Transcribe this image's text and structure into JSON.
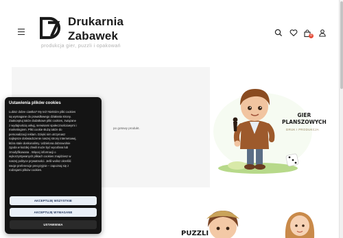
{
  "header": {
    "brand_line1": "Drukarnia",
    "brand_line2": "Zabawek",
    "tagline": "produkcja gier, puzzli i opakowań",
    "cart_count": "0",
    "icons": [
      "menu-icon",
      "search-icon",
      "heart-icon",
      "cart-icon",
      "user-icon"
    ]
  },
  "hero": {
    "text_fragment": "po gotowy produkt.",
    "banner_title_line1": "GIER",
    "banner_title_line2": "PLANSZOWYCH",
    "banner_subtitle": "DRUK I PRODUKCJA"
  },
  "second_banner": {
    "title": "PUZZLI"
  },
  "cookie_dialog": {
    "title": "Ustawienia plików cookies",
    "lines": [
      "Lubisz dobre ciastka? My też! Niektóre pliki cookies",
      "są wymagane do prawidłowego działania strony.",
      "Zaakceptuj także dodatkowe pliki cookies, związane",
      "z wydajnością usług, serwisami społecznościowymi i",
      "marketingiem. Pliki cookie służą także do",
      "personalizacji reklam. Dzięki nim otrzymasz",
      "najlepsze doświadczenie naszej strony internetowej,",
      "która stale doskonalimy. Udzielona dobrowolnie",
      "zgoda w każdej chwili może być wycofana lub",
      "zmodyfikowana . Więcej informacji o",
      "wykorzystywanych plikach cookies znajdziesz w",
      "naszej polityce prywatności. Jeśli wolisz określić",
      "swoje preferencje precyzyjnie – zapoznaj się z",
      "rodzajami plików cookies."
    ],
    "accept_all_label": "AKCEPTUJĘ WSZYSTKIE",
    "accept_required_label": "AKCEPTUJĘ WYMAGANE",
    "settings_label": "USTAWIENIA"
  },
  "colors": {
    "cookie_bg": "#141414",
    "button_light": "#e9eff7",
    "button_text": "#1b2f57",
    "badge": "#e44d3a"
  }
}
